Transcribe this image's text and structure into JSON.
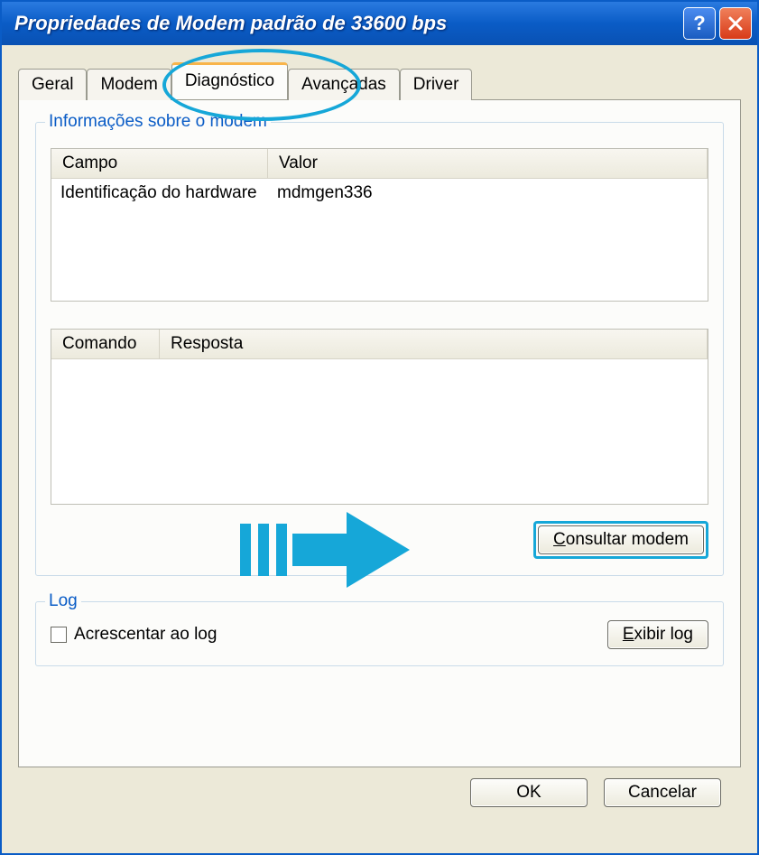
{
  "window": {
    "title": "Propriedades de Modem padrão de 33600 bps"
  },
  "tabs": {
    "geral": "Geral",
    "modem": "Modem",
    "diagnostico": "Diagnóstico",
    "avancadas": "Avançadas",
    "driver": "Driver"
  },
  "group_info": {
    "legend": "Informações sobre o modem",
    "headers": {
      "campo": "Campo",
      "valor": "Valor"
    },
    "row1": {
      "campo": "Identificação do hardware",
      "valor": "mdmgen336"
    }
  },
  "group_cmd": {
    "headers": {
      "comando": "Comando",
      "resposta": "Resposta"
    }
  },
  "buttons": {
    "consultar_pre": "C",
    "consultar_rest": "onsultar modem",
    "exibir_pre": "E",
    "exibir_rest": "xibir log",
    "ok": "OK",
    "cancelar": "Cancelar"
  },
  "log": {
    "legend": "Log",
    "checkbox_pre": "A",
    "checkbox_rest": "crescentar ao log"
  }
}
